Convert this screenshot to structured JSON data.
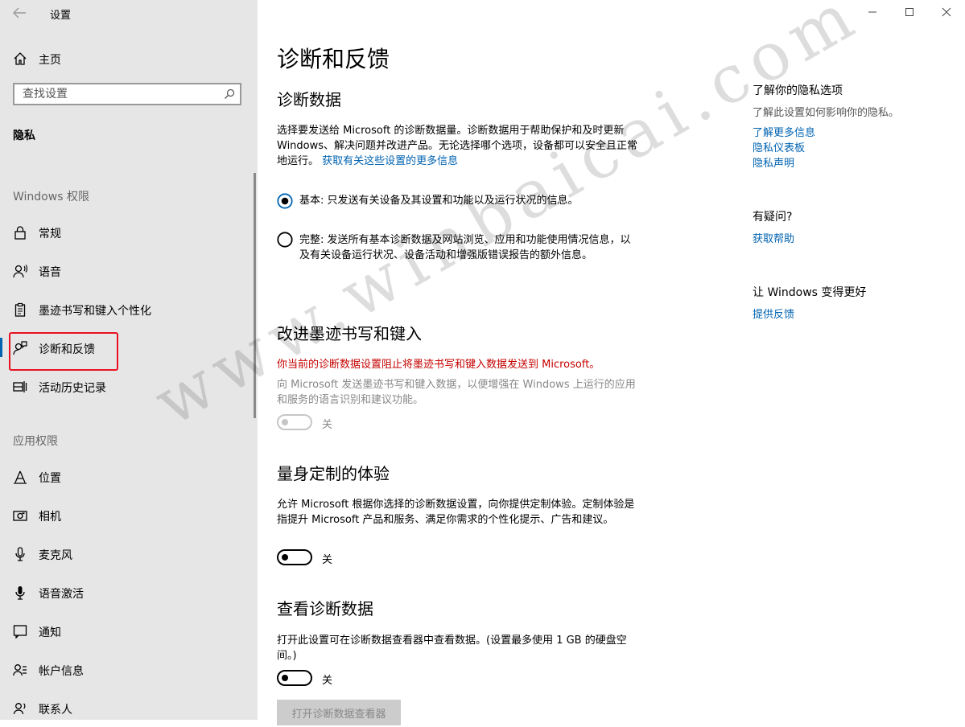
{
  "window": {
    "title": "设置",
    "back_icon": "arrow-left-icon",
    "controls": [
      "minimize-icon",
      "maximize-icon",
      "close-icon"
    ]
  },
  "sidebar": {
    "home": {
      "label": "主页",
      "icon": "home-icon"
    },
    "search": {
      "placeholder": "查找设置",
      "icon": "search-icon"
    },
    "section_title": "隐私",
    "windows_group": {
      "title": "Windows 权限",
      "items": [
        {
          "label": "常规",
          "icon": "lock-icon"
        },
        {
          "label": "语音",
          "icon": "speech-icon"
        },
        {
          "label": "墨迹书写和键入个性化",
          "icon": "clipboard-icon"
        },
        {
          "label": "诊断和反馈",
          "icon": "feedback-icon",
          "selected": true
        },
        {
          "label": "活动历史记录",
          "icon": "timeline-icon"
        }
      ]
    },
    "app_group": {
      "title": "应用权限",
      "items": [
        {
          "label": "位置",
          "icon": "location-icon"
        },
        {
          "label": "相机",
          "icon": "camera-icon"
        },
        {
          "label": "麦克风",
          "icon": "microphone-icon"
        },
        {
          "label": "语音激活",
          "icon": "voice-activation-icon"
        },
        {
          "label": "通知",
          "icon": "notification-icon"
        },
        {
          "label": "帐户信息",
          "icon": "account-info-icon"
        },
        {
          "label": "联系人",
          "icon": "contacts-icon"
        }
      ]
    }
  },
  "main": {
    "title": "诊断和反馈",
    "diagnostic_data": {
      "heading": "诊断数据",
      "desc": "选择要发送给 Microsoft 的诊断数据量。诊断数据用于帮助保护和及时更新 Windows、解决问题并改进产品。无论选择哪个选项，设备都可以安全且正常地运行。",
      "link": "获取有关这些设置的更多信息",
      "options": [
        {
          "label": "基本: 只发送有关设备及其设置和功能以及运行状况的信息。",
          "checked": true
        },
        {
          "label": "完整: 发送所有基本诊断数据及网站浏览、应用和功能使用情况信息，以及有关设备运行状况、设备活动和增强版错误报告的额外信息。",
          "checked": false
        }
      ]
    },
    "inking": {
      "heading": "改进墨迹书写和键入",
      "warning": "你当前的诊断数据设置阻止将墨迹书写和键入数据发送到 Microsoft。",
      "desc": "向 Microsoft 发送墨迹书写和键入数据，以便增强在 Windows 上运行的应用和服务的语言识别和建议功能。",
      "toggle_label": "关"
    },
    "tailored": {
      "heading": "量身定制的体验",
      "desc": "允许 Microsoft 根据你选择的诊断数据设置，向你提供定制体验。定制体验是指提升 Microsoft 产品和服务、满足你需求的个性化提示、广告和建议。",
      "toggle_label": "关"
    },
    "viewer": {
      "heading": "查看诊断数据",
      "desc": "打开此设置可在诊断数据查看器中查看数据。(设置最多使用 1 GB 的硬盘空间。)",
      "toggle_label": "关",
      "button": "打开诊断数据查看器"
    }
  },
  "right": {
    "privacy": {
      "heading": "了解你的隐私选项",
      "sub": "了解此设置如何影响你的隐私。",
      "links": [
        "了解更多信息",
        "隐私仪表板",
        "隐私声明"
      ]
    },
    "help": {
      "heading": "有疑问?",
      "link": "获取帮助"
    },
    "feedback": {
      "heading": "让 Windows 变得更好",
      "link": "提供反馈"
    }
  },
  "watermark": "www.winbaicai.com",
  "colors": {
    "accent": "#0063b1",
    "warning": "#c50000",
    "highlight_box": "#e81123"
  }
}
